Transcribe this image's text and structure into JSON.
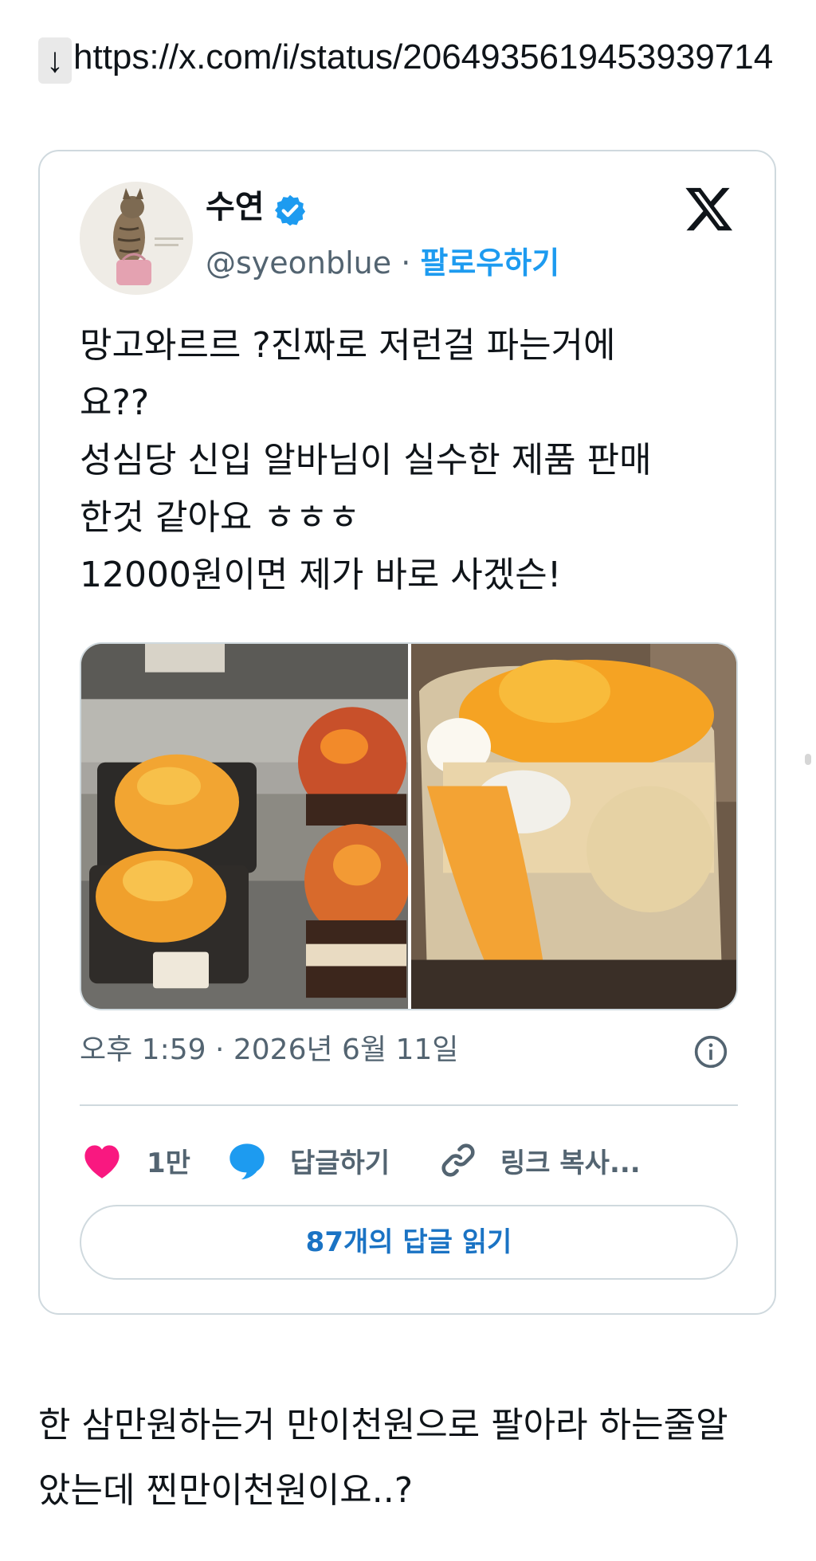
{
  "link": {
    "arrow": "↓",
    "url": "https://x.com/i/status/2064935619453939714"
  },
  "tweet": {
    "author_name": "수연",
    "handle": "@syeonblue",
    "separator": " · ",
    "follow_label": "팔로우하기",
    "text_lines": [
      "망고와르르 ?진짜로 저런걸 파는거에",
      "요??",
      "성심당 신입 알바님이 실수한 제품 판매",
      "한것 같아요 ㅎㅎㅎ",
      "12000원이면 제가 바로 사겠슨!"
    ],
    "timestamp": "오후 1:59 · 2026년 6월 11일",
    "likes": "1만",
    "reply_label": "답글하기",
    "copy_link_label": "링크 복사...",
    "read_replies_label": "87개의 답글 읽기",
    "accent_color": "#1d9bf0",
    "like_color": "#f91880"
  },
  "comment_lines": [
    "한 삼만원하는거 만이천원으로 팔아라 하는줄알",
    "았는데 찐만이천원이요..?"
  ],
  "icons": [
    "down-arrow-icon",
    "verified-badge-icon",
    "x-logo-icon",
    "info-icon",
    "heart-icon",
    "reply-bubble-icon",
    "link-icon"
  ]
}
